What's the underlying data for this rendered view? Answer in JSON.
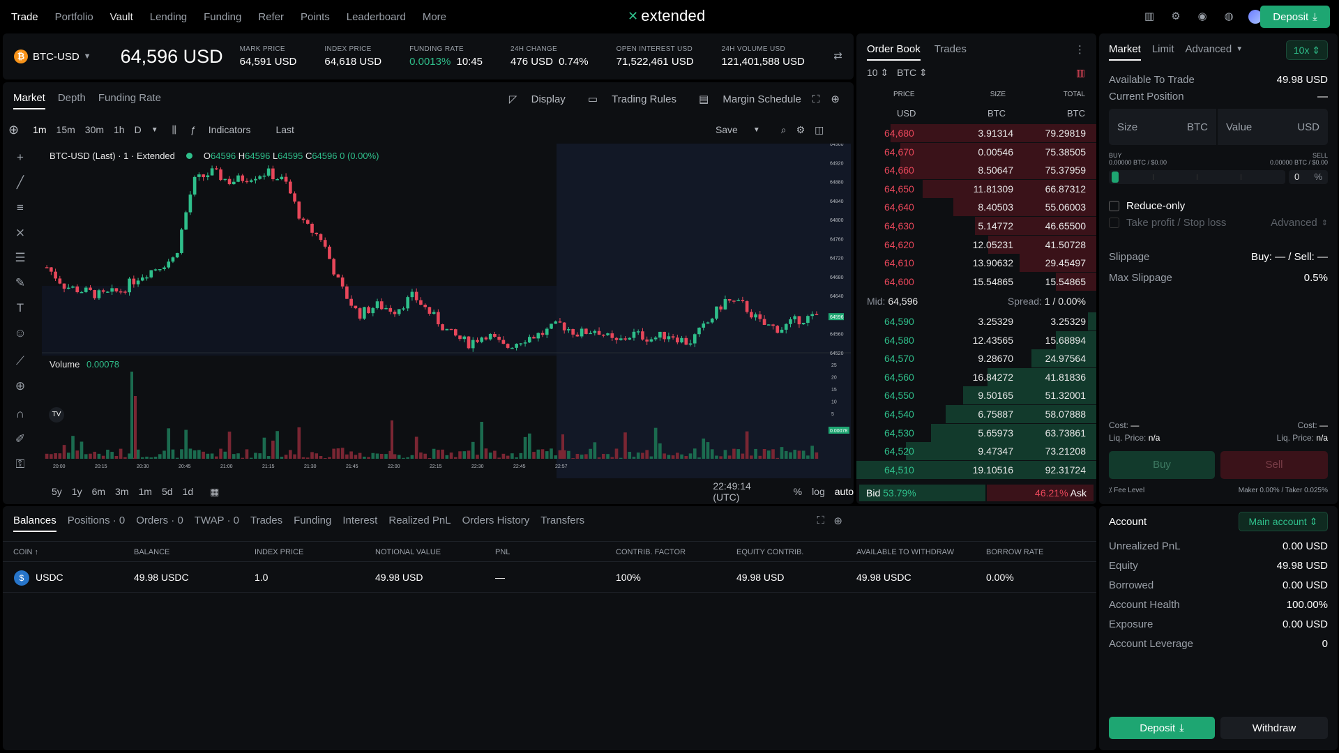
{
  "nav": {
    "items": [
      "Trade",
      "Portfolio",
      "Vault",
      "Lending",
      "Funding",
      "Refer",
      "Points",
      "Leaderboard",
      "More"
    ],
    "logo": "extended",
    "deposit_label": "Deposit"
  },
  "ticker": {
    "pair": "BTC-USD",
    "price": "64,596 USD",
    "stats": [
      {
        "label": "MARK PRICE",
        "value": "64,591 USD"
      },
      {
        "label": "INDEX PRICE",
        "value": "64,618 USD"
      },
      {
        "label": "FUNDING RATE",
        "value": "0.0013%",
        "extra": "10:45"
      },
      {
        "label": "24H CHANGE",
        "value": "476 USD",
        "extra": "0.74%"
      },
      {
        "label": "OPEN INTEREST USD",
        "value": "71,522,461 USD"
      },
      {
        "label": "24H VOLUME USD",
        "value": "121,401,588 USD"
      }
    ]
  },
  "chart": {
    "tabs": [
      "Market",
      "Depth",
      "Funding Rate"
    ],
    "tools": [
      "Display",
      "Trading Rules",
      "Margin Schedule"
    ],
    "intervals": [
      "1m",
      "15m",
      "30m",
      "1h",
      "D"
    ],
    "indicators_label": "Indicators",
    "last_label": "Last",
    "save_label": "Save",
    "legend_title": "BTC-USD (Last) · 1 · Extended",
    "legend_o": "64596",
    "legend_h": "64596",
    "legend_l": "64595",
    "legend_c": "64596",
    "legend_chg": "0 (0.00%)",
    "volume_label": "Volume",
    "volume_value": "0.00078",
    "time_ticks": [
      "20:00",
      "20:15",
      "20:30",
      "20:45",
      "21:00",
      "21:15",
      "21:30",
      "21:45",
      "22:00",
      "22:15",
      "22:30",
      "22:45",
      "22:57"
    ],
    "price_ticks": [
      "64960",
      "64920",
      "64880",
      "64840",
      "64800",
      "64760",
      "64720",
      "64680",
      "64640",
      "64600",
      "64560",
      "64520"
    ],
    "price_tag": "64596",
    "vol_ticks": [
      "25",
      "20",
      "15",
      "10",
      "5"
    ],
    "vol_tag": "0.00078",
    "ranges": [
      "5y",
      "1y",
      "6m",
      "3m",
      "1m",
      "5d",
      "1d"
    ],
    "clock": "22:49:14 (UTC)",
    "scale_opts": [
      "%",
      "log",
      "auto"
    ]
  },
  "chart_data": {
    "type": "candlestick",
    "x_range": [
      "20:00",
      "22:57"
    ],
    "ylim": [
      64520,
      64960
    ],
    "close_path": [
      64700,
      64660,
      64650,
      64640,
      64650,
      64680,
      64700,
      64720,
      64880,
      64900,
      64880,
      64890,
      64900,
      64880,
      64790,
      64760,
      64660,
      64600,
      64620,
      64610,
      64640,
      64600,
      64560,
      64540,
      64560,
      64530,
      64550,
      64560,
      64580,
      64560,
      64570,
      64540,
      64560,
      64550,
      64560,
      64540,
      64580,
      64630,
      64620,
      64580,
      64570,
      64590,
      64596
    ]
  },
  "orderbook": {
    "tabs": [
      "Order Book",
      "Trades"
    ],
    "depth": "10",
    "unit": "BTC",
    "headers": {
      "price": "PRICE",
      "price_unit": "USD",
      "size": "SIZE",
      "size_unit": "BTC",
      "total": "TOTAL",
      "total_unit": "BTC"
    },
    "asks": [
      {
        "p": "64,680",
        "s": "3.91314",
        "t": "79.29819"
      },
      {
        "p": "64,670",
        "s": "0.00546",
        "t": "75.38505"
      },
      {
        "p": "64,660",
        "s": "8.50647",
        "t": "75.37959"
      },
      {
        "p": "64,650",
        "s": "11.81309",
        "t": "66.87312"
      },
      {
        "p": "64,640",
        "s": "8.40503",
        "t": "55.06003"
      },
      {
        "p": "64,630",
        "s": "5.14772",
        "t": "46.65500"
      },
      {
        "p": "64,620",
        "s": "12.05231",
        "t": "41.50728"
      },
      {
        "p": "64,610",
        "s": "13.90632",
        "t": "29.45497"
      },
      {
        "p": "64,600",
        "s": "15.54865",
        "t": "15.54865"
      }
    ],
    "mid_label": "Mid:",
    "mid": "64,596",
    "spread_label": "Spread:",
    "spread": "1 / 0.00%",
    "bids": [
      {
        "p": "64,590",
        "s": "3.25329",
        "t": "3.25329"
      },
      {
        "p": "64,580",
        "s": "12.43565",
        "t": "15.68894"
      },
      {
        "p": "64,570",
        "s": "9.28670",
        "t": "24.97564"
      },
      {
        "p": "64,560",
        "s": "16.84272",
        "t": "41.81836"
      },
      {
        "p": "64,550",
        "s": "9.50165",
        "t": "51.32001"
      },
      {
        "p": "64,540",
        "s": "6.75887",
        "t": "58.07888"
      },
      {
        "p": "64,530",
        "s": "5.65973",
        "t": "63.73861"
      },
      {
        "p": "64,520",
        "s": "9.47347",
        "t": "73.21208"
      },
      {
        "p": "64,510",
        "s": "19.10516",
        "t": "92.31724"
      }
    ],
    "bid_label": "Bid",
    "bid_pct": "53.79%",
    "ask_label": "Ask",
    "ask_pct": "46.21%"
  },
  "trade": {
    "tabs": [
      "Market",
      "Limit",
      "Advanced"
    ],
    "leverage": "10x",
    "available_label": "Available To Trade",
    "available": "49.98 USD",
    "position_label": "Current Position",
    "position": "—",
    "size_label": "Size",
    "size_unit": "BTC",
    "value_label": "Value",
    "value_unit": "USD",
    "buy_label": "BUY",
    "buy_info": "0.00000 BTC / $0.00",
    "sell_label": "SELL",
    "sell_info": "0.00000 BTC / $0.00",
    "pct_value": "0",
    "pct_unit": "%",
    "reduce_only": "Reduce-only",
    "tpsl": "Take profit / Stop loss",
    "advanced": "Advanced",
    "slippage_label": "Slippage",
    "slippage": "Buy: — / Sell: —",
    "max_slippage_label": "Max Slippage",
    "max_slippage": "0.5%",
    "cost_label": "Cost:",
    "cost": "—",
    "liq_label": "Liq. Price:",
    "liq": "n/a",
    "buy_btn": "Buy",
    "sell_btn": "Sell",
    "fee_label": "Fee Level",
    "fee": "Maker 0.00% / Taker 0.025%"
  },
  "bottom": {
    "tabs": [
      "Balances",
      "Positions · 0",
      "Orders · 0",
      "TWAP · 0",
      "Trades",
      "Funding",
      "Interest",
      "Realized PnL",
      "Orders History",
      "Transfers"
    ],
    "headers": [
      "COIN ↑",
      "BALANCE",
      "INDEX PRICE",
      "NOTIONAL VALUE",
      "PNL",
      "CONTRIB. FACTOR",
      "EQUITY CONTRIB.",
      "AVAILABLE TO WITHDRAW",
      "BORROW RATE"
    ],
    "row": [
      "USDC",
      "49.98 USDC",
      "1.0",
      "49.98 USD",
      "—",
      "100%",
      "49.98 USD",
      "49.98 USDC",
      "0.00%"
    ]
  },
  "account": {
    "title": "Account",
    "selector": "Main account",
    "rows": [
      {
        "l": "Unrealized PnL",
        "v": "0.00 USD"
      },
      {
        "l": "Equity",
        "v": "49.98 USD"
      },
      {
        "l": "Borrowed",
        "v": "0.00 USD"
      },
      {
        "l": "Account Health",
        "v": "100.00%"
      },
      {
        "l": "Exposure",
        "v": "0.00 USD"
      },
      {
        "l": "Account Leverage",
        "v": "0"
      }
    ],
    "deposit_label": "Deposit",
    "withdraw_label": "Withdraw"
  },
  "colors": {
    "accent": "#1ea672",
    "up": "#2fbf8b",
    "down": "#e8475a",
    "panel": "#0d0f12"
  }
}
